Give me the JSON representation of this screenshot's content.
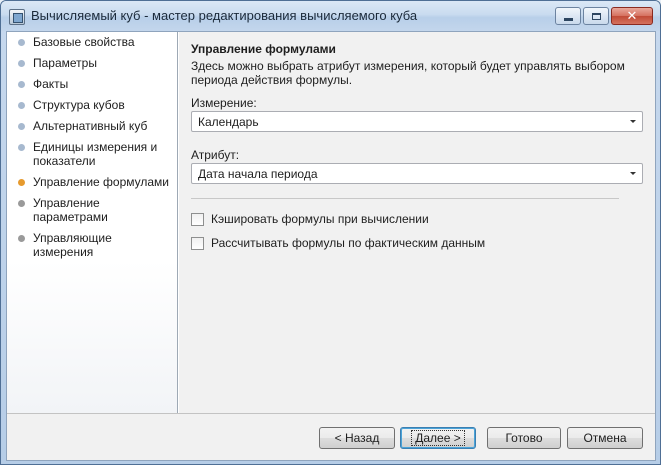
{
  "window": {
    "title": "Вычисляемый куб - мастер редактирования вычисляемого куба",
    "buttons": {
      "close_glyph": "✕"
    }
  },
  "sidebar": {
    "items": [
      {
        "label": "Базовые свойства",
        "state": "visited"
      },
      {
        "label": "Параметры",
        "state": "visited"
      },
      {
        "label": "Факты",
        "state": "visited"
      },
      {
        "label": "Структура кубов",
        "state": "visited"
      },
      {
        "label": "Альтернативный куб",
        "state": "visited"
      },
      {
        "label": "Единицы измерения и показатели",
        "state": "visited"
      },
      {
        "label": "Управление формулами",
        "state": "active"
      },
      {
        "label": "Управление параметрами",
        "state": "pending"
      },
      {
        "label": "Управляющие измерения",
        "state": "pending"
      }
    ]
  },
  "main": {
    "heading": "Управление формулами",
    "description": "Здесь можно выбрать атрибут измерения, который будет управлять выбором периода действия формулы.",
    "dimension": {
      "label": "Измерение:",
      "value": "Календарь"
    },
    "attribute": {
      "label": "Атрибут:",
      "value": "Дата начала периода"
    },
    "checkboxes": [
      {
        "label": "Кэшировать формулы при вычислении",
        "checked": false
      },
      {
        "label": "Рассчитывать формулы по фактическим данным",
        "checked": false
      }
    ]
  },
  "footer": {
    "back": "< Назад",
    "next": "Далее >",
    "finish": "Готово",
    "cancel": "Отмена"
  },
  "colors": {
    "active_dot": "#e69a2e",
    "visited_dot": "#a7b9cf",
    "pending_dot": "#9a9a9a"
  }
}
